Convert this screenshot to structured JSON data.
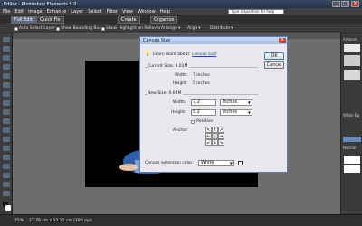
{
  "app": {
    "title": "Editor - Photoshop Elements 5.0",
    "help_placeholder": "Type a question for help"
  },
  "menu": [
    "File",
    "Edit",
    "Image",
    "Enhance",
    "Layer",
    "Select",
    "Filter",
    "View",
    "Window",
    "Help"
  ],
  "modes": {
    "full_edit": "Full Edit",
    "quick_fix": "Quick Fix",
    "create": "Create",
    "organize": "Organize"
  },
  "options": {
    "auto_select": "Auto Select Layer",
    "bounding_box": "Show Bounding Box",
    "highlight": "Show Highlight on Rollover",
    "arrange": "Arrange",
    "align": "Align",
    "distribute": "Distribute"
  },
  "palette": {
    "artwork": "Artwork",
    "normal": "Normal",
    "white_bg": "White Bg"
  },
  "status": {
    "zoom": "25%",
    "dims": "27.78 cm x 22.22 cm (180 ppi)"
  },
  "dialog": {
    "title": "Canvas Size",
    "learn_prefix": "Learn more about:",
    "learn_link": "Canvas Size",
    "ok": "OK",
    "cancel": "Cancel",
    "current_size_label": "Current Size: 9.01M",
    "current_width_label": "Width:",
    "current_width_value": "7 inches",
    "current_height_label": "Height:",
    "current_height_value": "5 inches",
    "new_size_label": "New Size: 9.64M",
    "new_width_label": "Width:",
    "new_width_value": "7.2",
    "new_width_unit": "inches",
    "new_height_label": "Height:",
    "new_height_value": "5.2",
    "new_height_unit": "inches",
    "relative_label": "Relative",
    "anchor_label": "Anchor:",
    "ext_color_label": "Canvas extension color:",
    "ext_color_value": "White",
    "ext_color_swatch": "#ffffff"
  }
}
